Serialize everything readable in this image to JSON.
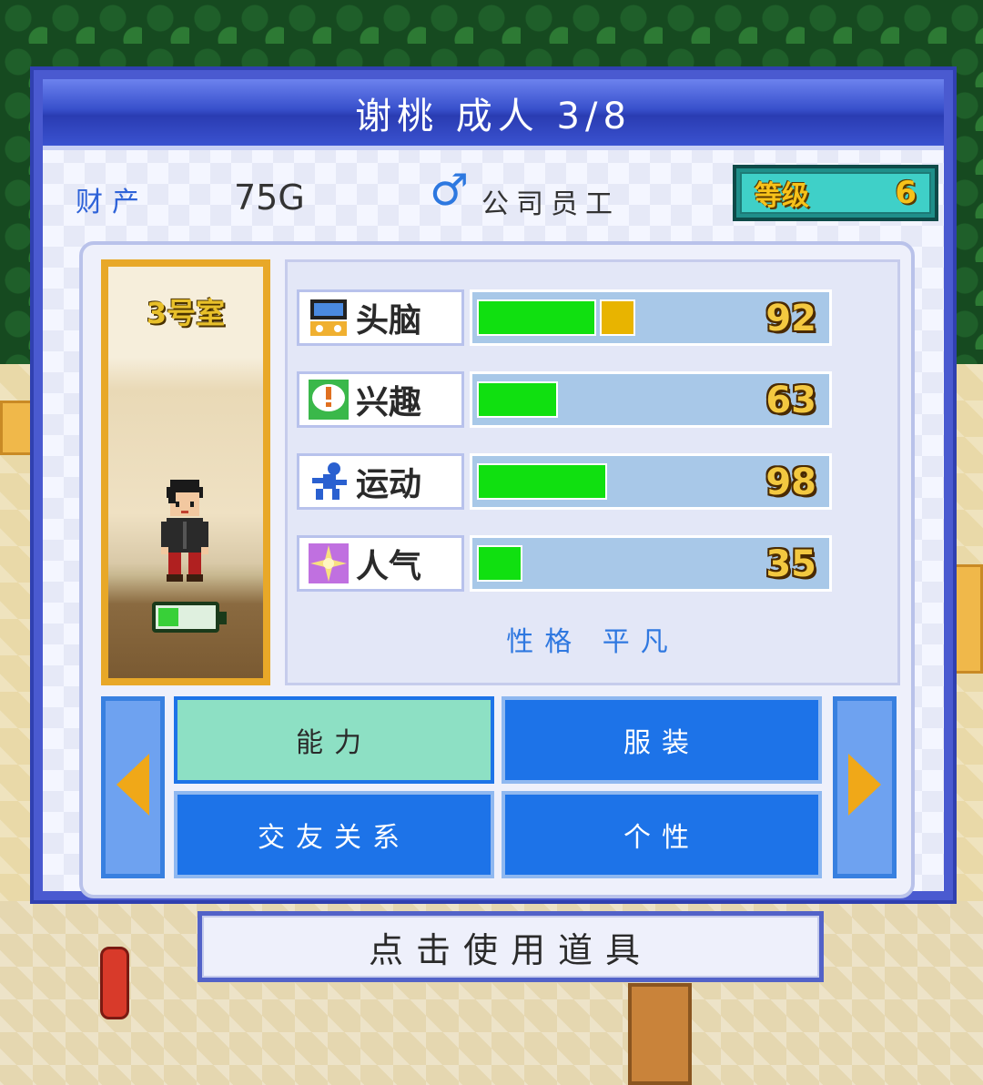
{
  "header": {
    "title": "谢桃 成人 3/8"
  },
  "info": {
    "assets_label": "财产",
    "assets_value": "75G",
    "job_label": "公司员工",
    "level_label": "等级",
    "level_value": "6"
  },
  "room": {
    "name": "3号室",
    "stamina_fraction": 0.34
  },
  "stats": [
    {
      "label": "头脑",
      "value": "92",
      "icon": "brain-icon",
      "bar_fraction": 0.34,
      "extra_fraction": 0.1
    },
    {
      "label": "兴趣",
      "value": "63",
      "icon": "exclamation-bubble-icon",
      "bar_fraction": 0.23,
      "extra_fraction": 0
    },
    {
      "label": "运动",
      "value": "98",
      "icon": "runner-icon",
      "bar_fraction": 0.37,
      "extra_fraction": 0
    },
    {
      "label": "人气",
      "value": "35",
      "icon": "sparkle-icon",
      "bar_fraction": 0.13,
      "extra_fraction": 0
    }
  ],
  "personality": "性格 平凡",
  "tabs": {
    "ability": "能力",
    "clothing": "服装",
    "friendship": "交友关系",
    "personality": "个性"
  },
  "footer": {
    "use_item": "点击使用道具"
  },
  "colors": {
    "panel_blue": "#4a5ad0",
    "tab_blue": "#1d73e8",
    "tab_active": "#8de0c4",
    "bar_green": "#10e010",
    "bar_bonus": "#e8b400",
    "value_gold": "#f3c840"
  }
}
